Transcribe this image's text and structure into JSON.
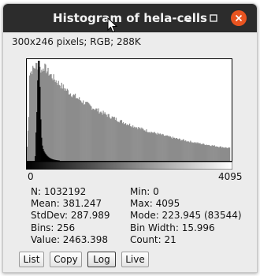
{
  "window": {
    "title": "Histogram of hela-cells",
    "controls": {
      "minimize": "minimize-icon",
      "maximize": "maximize-icon",
      "close": "close-icon"
    },
    "colors": {
      "titlebar": "#2c2c2c",
      "close": "#e95420"
    }
  },
  "image_info": "300x246 pixels; RGB; 288K",
  "axis": {
    "min_label": "0",
    "max_label": "4095"
  },
  "stats_left": [
    "N: 1032192",
    "Mean: 381.247",
    "StdDev: 287.989",
    "Bins: 256",
    "Value: 2463.398"
  ],
  "stats_right": [
    "Min: 0",
    "Max: 4095",
    "Mode: 223.945 (83544)",
    "Bin Width: 15.996",
    "Count: 21"
  ],
  "buttons": {
    "list": "List",
    "copy": "Copy",
    "log": "Log",
    "live": "Live"
  }
}
